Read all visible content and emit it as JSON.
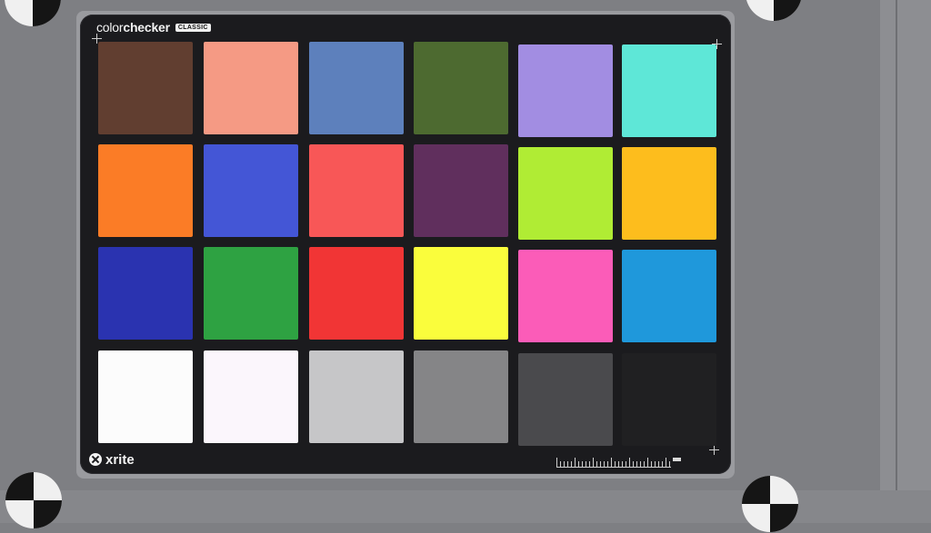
{
  "scene": {
    "description_role": "ColorChecker Classic target photographed on gray board",
    "brand": {
      "name_light": "color",
      "name_bold": "checker",
      "badge": "CLASSIC"
    },
    "maker_logo": "xrite",
    "patch_rows": [
      [
        {
          "name": "dark-skin",
          "color": "#613e30"
        },
        {
          "name": "light-skin",
          "color": "#f59a84"
        },
        {
          "name": "blue-sky",
          "color": "#5d80bc"
        },
        {
          "name": "foliage",
          "color": "#4d6a30"
        },
        {
          "name": "blue-flower",
          "color": "#a28de2"
        },
        {
          "name": "bluish-green",
          "color": "#5ee7d7"
        }
      ],
      [
        {
          "name": "orange",
          "color": "#fb7c26"
        },
        {
          "name": "purplish-blue",
          "color": "#4456d6"
        },
        {
          "name": "moderate-red",
          "color": "#f85757"
        },
        {
          "name": "purple",
          "color": "#602f5d"
        },
        {
          "name": "yellow-green",
          "color": "#b0ec34"
        },
        {
          "name": "orange-yellow",
          "color": "#fdbd1d"
        }
      ],
      [
        {
          "name": "blue",
          "color": "#2a33b0"
        },
        {
          "name": "green",
          "color": "#2ea242"
        },
        {
          "name": "red",
          "color": "#f13535"
        },
        {
          "name": "yellow",
          "color": "#fafd3c"
        },
        {
          "name": "magenta",
          "color": "#fb5cb8"
        },
        {
          "name": "cyan",
          "color": "#1f98db"
        }
      ],
      [
        {
          "name": "white",
          "color": "#fcfcfc"
        },
        {
          "name": "neutral-8",
          "color": "#fbf6fc"
        },
        {
          "name": "neutral-6-5",
          "color": "#c6c6c8"
        },
        {
          "name": "neutral-5",
          "color": "#858587"
        },
        {
          "name": "neutral-3-5",
          "color": "#4a4a4d"
        },
        {
          "name": "black",
          "color": "#202022"
        }
      ]
    ],
    "colors": {
      "card": "#1b1b1e",
      "board": "#9a9b9f",
      "background": "#7e7f83"
    }
  }
}
